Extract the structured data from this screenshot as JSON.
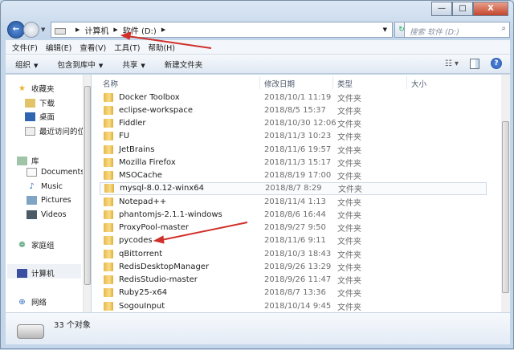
{
  "address": {
    "parts": [
      "计算机",
      "软件 (D:)"
    ]
  },
  "search": {
    "placeholder": "搜索 软件 (D:)"
  },
  "window_controls": {
    "minimize": "—",
    "maximize": "□",
    "close": "X"
  },
  "menu": [
    "文件(F)",
    "编辑(E)",
    "查看(V)",
    "工具(T)",
    "帮助(H)"
  ],
  "toolbar": {
    "organize": "组织",
    "include": "包含到库中",
    "share": "共享",
    "new_folder": "新建文件夹"
  },
  "sidebar": {
    "favorites": "收藏夹",
    "downloads": "下载",
    "desktop": "桌面",
    "recent": "最近访问的位",
    "library": "库",
    "documents": "Documents",
    "music": "Music",
    "pictures": "Pictures",
    "videos": "Videos",
    "homegroup": "家庭组",
    "computer": "计算机",
    "network": "网络"
  },
  "columns": {
    "name": "名称",
    "date": "修改日期",
    "type": "类型",
    "size": "大小"
  },
  "files": [
    {
      "name": "Docker Toolbox",
      "date": "2018/10/1 11:19",
      "type": "文件夹"
    },
    {
      "name": "eclipse-workspace",
      "date": "2018/8/5 15:37",
      "type": "文件夹"
    },
    {
      "name": "Fiddler",
      "date": "2018/10/30 12:06",
      "type": "文件夹"
    },
    {
      "name": "FU",
      "date": "2018/11/3 10:23",
      "type": "文件夹"
    },
    {
      "name": "JetBrains",
      "date": "2018/11/6 19:57",
      "type": "文件夹"
    },
    {
      "name": "Mozilla Firefox",
      "date": "2018/11/3 15:17",
      "type": "文件夹"
    },
    {
      "name": "MSOCache",
      "date": "2018/8/19 17:00",
      "type": "文件夹"
    },
    {
      "name": "mysql-8.0.12-winx64",
      "date": "2018/8/7 8:29",
      "type": "文件夹"
    },
    {
      "name": "Notepad++",
      "date": "2018/11/4 1:13",
      "type": "文件夹"
    },
    {
      "name": "phantomjs-2.1.1-windows",
      "date": "2018/8/6 16:44",
      "type": "文件夹"
    },
    {
      "name": "ProxyPool-master",
      "date": "2018/9/27 9:50",
      "type": "文件夹"
    },
    {
      "name": "pycodes",
      "date": "2018/11/6 9:11",
      "type": "文件夹"
    },
    {
      "name": "qBittorrent",
      "date": "2018/10/3 18:43",
      "type": "文件夹"
    },
    {
      "name": "RedisDesktopManager",
      "date": "2018/9/26 13:29",
      "type": "文件夹"
    },
    {
      "name": "RedisStudio-master",
      "date": "2018/9/26 11:47",
      "type": "文件夹"
    },
    {
      "name": "Ruby25-x64",
      "date": "2018/8/7 13:36",
      "type": "文件夹"
    },
    {
      "name": "SogouInput",
      "date": "2018/10/14 9:45",
      "type": "文件夹"
    }
  ],
  "status": {
    "count": "33 个对象"
  },
  "colors": {
    "annotation_arrow": "#d0302a",
    "folder": "#e9bd52"
  }
}
